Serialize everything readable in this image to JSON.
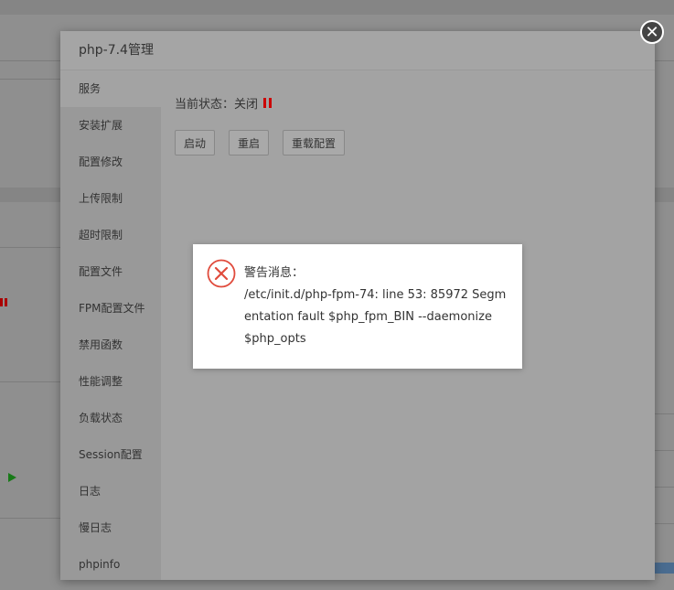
{
  "modal": {
    "title": "php-7.4管理",
    "sidebar": [
      {
        "label": "服务",
        "active": true
      },
      {
        "label": "安装扩展"
      },
      {
        "label": "配置修改"
      },
      {
        "label": "上传限制"
      },
      {
        "label": "超时限制"
      },
      {
        "label": "配置文件"
      },
      {
        "label": "FPM配置文件"
      },
      {
        "label": "禁用函数"
      },
      {
        "label": "性能调整"
      },
      {
        "label": "负载状态"
      },
      {
        "label": "Session配置"
      },
      {
        "label": "日志"
      },
      {
        "label": "慢日志"
      },
      {
        "label": "phpinfo"
      }
    ],
    "status_label": "当前状态：关闭",
    "buttons": {
      "start": "启动",
      "restart": "重启",
      "reload": "重载配置"
    },
    "close_icon": "close-icon"
  },
  "alert": {
    "title": "警告消息：",
    "message": "/etc/init.d/php-fpm-74: line 53: 85972 Segmentation fault $php_fpm_BIN --daemonize $php_opts",
    "icon": "error-icon"
  },
  "colors": {
    "error": "#e04b3c",
    "paused": "#cc0000",
    "running": "#1a9a1a"
  }
}
